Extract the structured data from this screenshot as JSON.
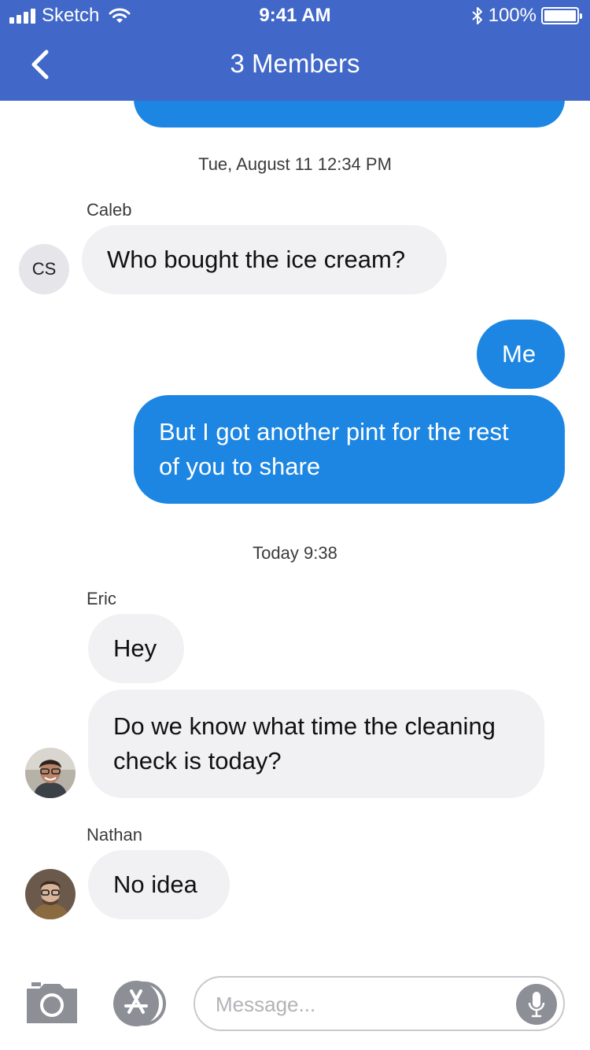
{
  "status_bar": {
    "carrier": "Sketch",
    "time": "9:41 AM",
    "battery_percent": "100%",
    "battery_level": 1.0
  },
  "nav": {
    "title": "3 Members",
    "back_icon": "chevron-left-icon"
  },
  "messages": {
    "top_partial": {
      "direction": "outgoing",
      "text": ""
    },
    "stamp_1": "Tue, August 11 12:34 PM",
    "caleb": {
      "sender": "Caleb",
      "initials": "CS",
      "text": "Who bought the ice cream?"
    },
    "me_1": "Me",
    "me_2_line1": "But I got another pint for the rest",
    "me_2_line2": "of you to share",
    "stamp_2": "Today 9:38",
    "eric": {
      "sender": "Eric",
      "text_1": "Hey",
      "text_2_line1": "Do we know what time the cleaning",
      "text_2_line2": "check is today?"
    },
    "nathan": {
      "sender": "Nathan",
      "text": "No idea"
    }
  },
  "input_bar": {
    "placeholder": "Message...",
    "value": "",
    "camera_icon": "camera-icon",
    "apps_icon": "app-store-icon",
    "mic_icon": "microphone-icon"
  },
  "colors": {
    "header": "#4168c8",
    "outgoing_bubble": "#1d86e2",
    "incoming_bubble": "#f1f1f3",
    "icon_gray": "#8c8f96"
  }
}
